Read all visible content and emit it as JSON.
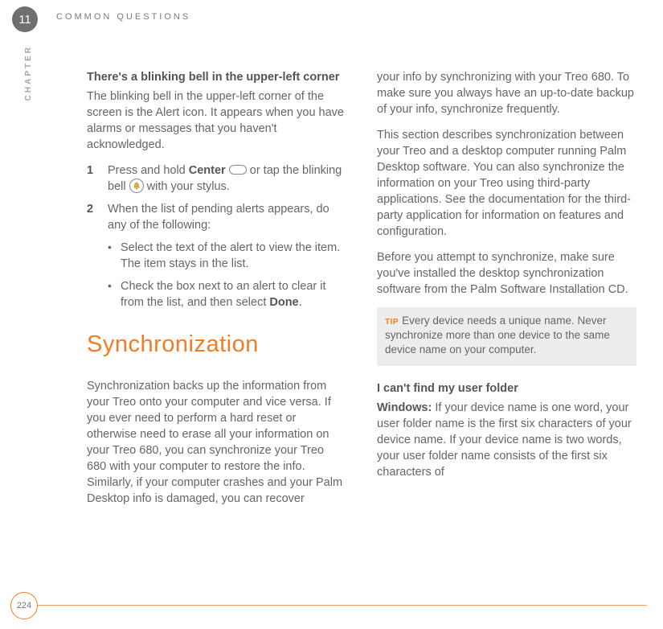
{
  "chapterNumber": "11",
  "runningHead": "COMMON QUESTIONS",
  "chapterLabel": "CHAPTER",
  "pageNumber": "224",
  "accent": "#f47c20",
  "leftCol": {
    "subhead1": "There's a blinking bell in the upper-left corner",
    "p1": "The blinking bell in the upper-left corner of the screen is the Alert icon. It appears when you have alarms or messages that you haven't acknowledged.",
    "step1": {
      "num": "1",
      "textA": "Press and hold ",
      "bold": "Center",
      "textB": " or tap the blinking bell ",
      "textC": " with your stylus."
    },
    "step2": {
      "num": "2",
      "text": "When the list of pending alerts appears, do any of the following:"
    },
    "bullet1": "Select the text of the alert to view the item. The item stays in the list.",
    "bullet2a": "Check the box next to an alert to clear it from the list, and then select ",
    "bullet2bold": "Done",
    "bullet2b": ".",
    "sectionTitle": "Synchronization",
    "p2": "Synchronization backs up the information from your Treo onto your computer and vice versa. If you ever need to perform a hard reset or otherwise need to erase all your information on your Treo 680, you can synchronize your Treo 680 with your computer to restore the info. Similarly, if your computer crashes and your Palm Desktop info is damaged, you can recover"
  },
  "rightCol": {
    "p1": "your info by synchronizing with your Treo 680. To make sure you always have an up-to-date backup of your info, synchronize frequently.",
    "p2": "This section describes synchronization between your Treo and a desktop computer running Palm Desktop software. You can also synchronize the information on your Treo using third-party applications. See the documentation for the third-party application for information on features and configuration.",
    "p3": "Before you attempt to synchronize, make sure you've installed the desktop synchronization software from the Palm Software Installation CD.",
    "tipLabel": "TIP",
    "tipText": "Every device needs a unique name. Never synchronize more than one device to the same device name on your computer.",
    "subhead2": "I can't find my user folder",
    "p4bold": "Windows:",
    "p4": " If your device name is one word, your user folder name is the first six characters of your device name. If your device name is two words, your user folder name consists of the first six characters of"
  }
}
